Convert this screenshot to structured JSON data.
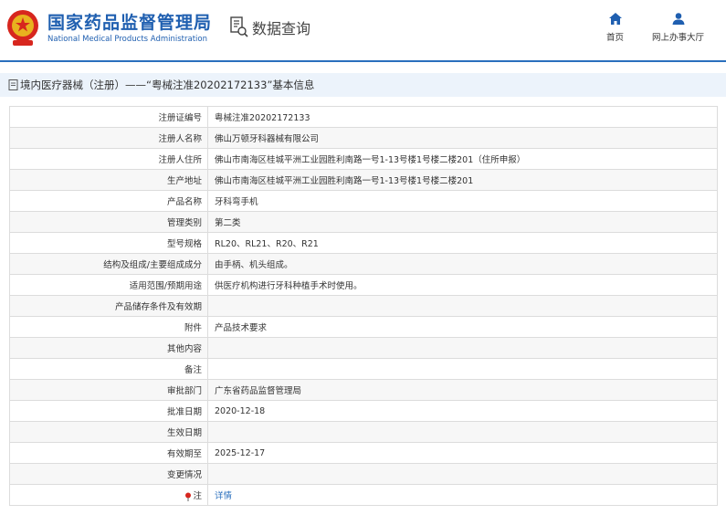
{
  "header": {
    "org_cn": "国家药品监督管理局",
    "org_en": "National Medical Products Administration",
    "query_label": "数据查询",
    "nav": [
      {
        "label": "首页",
        "icon": "home-icon"
      },
      {
        "label": "网上办事大厅",
        "icon": "user-icon"
      }
    ]
  },
  "breadcrumb": {
    "text": "境内医疗器械（注册）——“粤械注准20202172133”基本信息"
  },
  "record": {
    "rows": [
      {
        "label": "注册证编号",
        "value": "粤械注准20202172133"
      },
      {
        "label": "注册人名称",
        "value": "佛山万顿牙科器械有限公司"
      },
      {
        "label": "注册人住所",
        "value": "佛山市南海区桂城平洲工业园胜利南路一号1-13号楼1号楼二楼201（住所申报）"
      },
      {
        "label": "生产地址",
        "value": "佛山市南海区桂城平洲工业园胜利南路一号1-13号楼1号楼二楼201"
      },
      {
        "label": "产品名称",
        "value": "牙科弯手机"
      },
      {
        "label": "管理类别",
        "value": "第二类"
      },
      {
        "label": "型号规格",
        "value": "RL20、RL21、R20、R21"
      },
      {
        "label": "结构及组成/主要组成成分",
        "value": "由手柄、机头组成。"
      },
      {
        "label": "适用范围/预期用途",
        "value": "供医疗机构进行牙科种植手术时使用。"
      },
      {
        "label": "产品储存条件及有效期",
        "value": ""
      },
      {
        "label": "附件",
        "value": "产品技术要求"
      },
      {
        "label": "其他内容",
        "value": ""
      },
      {
        "label": "备注",
        "value": ""
      },
      {
        "label": "审批部门",
        "value": "广东省药品监督管理局"
      },
      {
        "label": "批准日期",
        "value": "2020-12-18"
      },
      {
        "label": "生效日期",
        "value": ""
      },
      {
        "label": "有效期至",
        "value": "2025-12-17"
      },
      {
        "label": "变更情况",
        "value": ""
      }
    ],
    "note_label": "注",
    "note_icon": "pin-icon",
    "note_link": "详情"
  },
  "colors": {
    "brand_blue": "#1f5fb0",
    "crumb_bg": "#ecf3fb",
    "link": "#2a6fbd"
  }
}
